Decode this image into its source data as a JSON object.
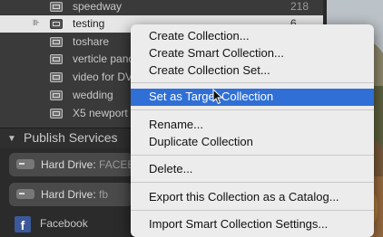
{
  "collections": {
    "rows": [
      {
        "name": "speedway",
        "count": "218"
      },
      {
        "name": "testing",
        "count": "6",
        "selected": true
      },
      {
        "name": "toshare",
        "count": ""
      },
      {
        "name": "verticle panoramas",
        "count": ""
      },
      {
        "name": "video for DVD",
        "count": ""
      },
      {
        "name": "wedding",
        "count": ""
      },
      {
        "name": "X5 newport",
        "count": ""
      }
    ]
  },
  "publish_services": {
    "title": "Publish Services",
    "hard_drive_1": {
      "label": "Hard Drive",
      "detail": "FACEBOOK"
    },
    "hard_drive_2": {
      "label": "Hard Drive",
      "detail": "fb"
    },
    "facebook": {
      "label": "Facebook"
    }
  },
  "context_menu": {
    "items": [
      {
        "label": "Create Collection..."
      },
      {
        "label": "Create Smart Collection..."
      },
      {
        "label": "Create Collection Set..."
      },
      {
        "label": "Set as Target Collection",
        "highlighted": true
      },
      {
        "label": "Rename..."
      },
      {
        "label": "Duplicate Collection"
      },
      {
        "label": "Delete..."
      },
      {
        "label": "Export this Collection as a Catalog..."
      },
      {
        "label": "Import Smart Collection Settings..."
      }
    ]
  },
  "colors": {
    "menu_highlight": "#2f6fd6",
    "menu_background": "#ececec",
    "panel_background": "#3a3a3a",
    "selected_row": "#e6e6e6"
  }
}
